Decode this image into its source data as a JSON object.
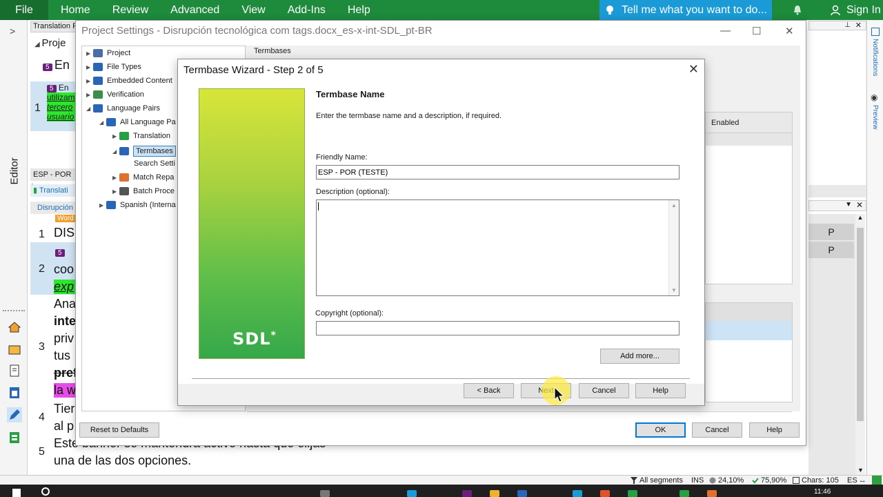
{
  "ribbon": {
    "file_label": "File",
    "tabs": [
      "Home",
      "Review",
      "Advanced",
      "View",
      "Add-Ins",
      "Help"
    ],
    "tell_me": "Tell me what you want to do...",
    "sign_in": "Sign In"
  },
  "left_nav": {
    "editor_label": "Editor"
  },
  "background_editor": {
    "panel_title": "Translation F",
    "project_label": "Proje",
    "seg_tag": "5",
    "seg_en": "En",
    "seg1_lines": [
      "utilizam",
      "tercero",
      "usuario"
    ],
    "lang_pair": "ESP - POR (",
    "translate_tab": "Translati",
    "doc_tab": "Disrupción",
    "rows": [
      {
        "num": "1",
        "text": "DIS"
      },
      {
        "num": "2",
        "text": "coo"
      },
      {
        "num": "3",
        "text": "Ana"
      },
      {
        "num": "4",
        "text": "Tier"
      },
      {
        "num": "5",
        "text": "Este banner se mantendrá activo hasta que elijas"
      }
    ],
    "row2_italic": "exp",
    "row3_lines": [
      "inte",
      "priv",
      "tus",
      "pref",
      "la w"
    ],
    "row4_line2": "al p",
    "row5_line2": "una de las dos opciones.",
    "word_tag": "Word",
    "right_P": [
      "P",
      "P"
    ],
    "notifications_label": "Notifications",
    "preview_label": "Preview"
  },
  "project_settings": {
    "title": "Project Settings - Disrupción tecnológica com tags.docx_es-x-int-SDL_pt-BR",
    "section_header": "Termbases",
    "tree": [
      {
        "label": "Project",
        "indent": 0,
        "arrow": "▶"
      },
      {
        "label": "File Types",
        "indent": 0,
        "arrow": "▶"
      },
      {
        "label": "Embedded Content",
        "indent": 0,
        "arrow": "▶"
      },
      {
        "label": "Verification",
        "indent": 0,
        "arrow": "▶"
      },
      {
        "label": "Language Pairs",
        "indent": 0,
        "arrow": "◢"
      },
      {
        "label": "All Language Pa",
        "indent": 1,
        "arrow": "◢"
      },
      {
        "label": "Translation",
        "indent": 2,
        "arrow": "▶"
      },
      {
        "label": "Termbases",
        "indent": 2,
        "arrow": "◢",
        "selected": true
      },
      {
        "label": "Search Setti",
        "indent": 3,
        "arrow": ""
      },
      {
        "label": "Match Repa",
        "indent": 2,
        "arrow": "▶"
      },
      {
        "label": "Batch Proce",
        "indent": 2,
        "arrow": "▶"
      },
      {
        "label": "Spanish (Interna",
        "indent": 1,
        "arrow": "▶"
      }
    ],
    "enabled_header": "Enabled",
    "reset_label": "Reset to Defaults",
    "ok_label": "OK",
    "cancel_label": "Cancel",
    "help_label": "Help"
  },
  "wizard": {
    "title": "Termbase Wizard - Step 2 of 5",
    "heading": "Termbase Name",
    "description": "Enter the termbase name and a description, if required.",
    "friendly_name_label": "Friendly Name:",
    "friendly_name_value": "ESP - POR (TESTE)",
    "description_label": "Description (optional):",
    "description_value": "",
    "copyright_label": "Copyright (optional):",
    "copyright_value": "",
    "add_more_label": "Add more...",
    "back_label": "< Back",
    "next_label": "Next",
    "cancel_label": "Cancel",
    "help_label": "Help",
    "logo_text": "SDL",
    "logo_star": "*"
  },
  "status_bar": {
    "all_segments": "All segments",
    "ins": "INS",
    "pct1": "24,10%",
    "pct2": "75,90%",
    "chars": "Chars: 105",
    "lang": "ES"
  },
  "taskbar": {
    "time": "11:46"
  },
  "colors": {
    "ribbon_green": "#1e8a3c",
    "tell_me_blue": "#1a9bd7",
    "selection_blue": "#cce4f7",
    "tag_purple": "#6b1f7a",
    "highlight_green": "#2ee62e",
    "highlight_pink": "#e84ce8"
  }
}
